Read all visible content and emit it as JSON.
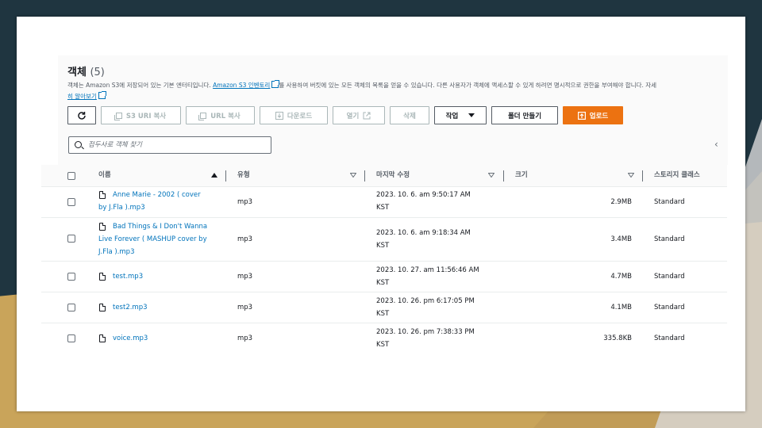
{
  "header": {
    "title": "객체",
    "count": "(5)",
    "desc_pre": "객체는 Amazon S3에 저장되어 있는 기본 엔터티입니다. ",
    "desc_link1": "Amazon S3 인벤토리",
    "desc_mid": "를 사용하여 버킷에 있는 모든 객체의 목록을 얻을 수 있습니다. 다른 사용자가 객체에 액세스할 수 있게 하려면 명시적으로 권한을 부여해야 합니다. 자세",
    "desc_link2": "히 알아보기"
  },
  "toolbar": {
    "s3_uri_copy": "S3 URI 복사",
    "url_copy": "URL 복사",
    "download": "다운로드",
    "open": "열기",
    "delete": "삭제",
    "actions": "작업",
    "create_folder": "폴더 만들기",
    "upload": "업로드"
  },
  "search": {
    "placeholder": "접두사로 객체 찾기"
  },
  "table": {
    "columns": {
      "name": "이름",
      "type": "유형",
      "modified": "마지막 수정",
      "size": "크기",
      "storage": "스토리지 클래스"
    },
    "rows": [
      {
        "name_lines": [
          "Anne Marie - 2002 ( cover",
          "by J.Fla ).mp3"
        ],
        "type": "mp3",
        "modified_lines": [
          "2023. 10. 6. am 9:50:17 AM",
          "KST"
        ],
        "size": "2.9MB",
        "storage": "Standard"
      },
      {
        "name_lines": [
          "Bad Things & I Don't Wanna",
          "Live Forever ( MASHUP cover by",
          "J.Fla ).mp3"
        ],
        "type": "mp3",
        "modified_lines": [
          "2023. 10. 6. am 9:18:34 AM",
          "KST"
        ],
        "size": "3.4MB",
        "storage": "Standard"
      },
      {
        "name_lines": [
          "test.mp3"
        ],
        "type": "mp3",
        "modified_lines": [
          "2023. 10. 27. am 11:56:46 AM",
          "KST"
        ],
        "size": "4.7MB",
        "storage": "Standard"
      },
      {
        "name_lines": [
          "test2.mp3"
        ],
        "type": "mp3",
        "modified_lines": [
          "2023. 10. 26. pm 6:17:05 PM",
          "KST"
        ],
        "size": "4.1MB",
        "storage": "Standard"
      },
      {
        "name_lines": [
          "voice.mp3"
        ],
        "type": "mp3",
        "modified_lines": [
          "2023. 10. 26. pm 7:38:33 PM",
          "KST"
        ],
        "size": "335.8KB",
        "storage": "Standard"
      }
    ]
  },
  "colors": {
    "accent": "#ec7211",
    "link": "#0073bb",
    "slide_bg_dark": "#1f3540",
    "slide_bg_gold": "#c9a45a"
  }
}
